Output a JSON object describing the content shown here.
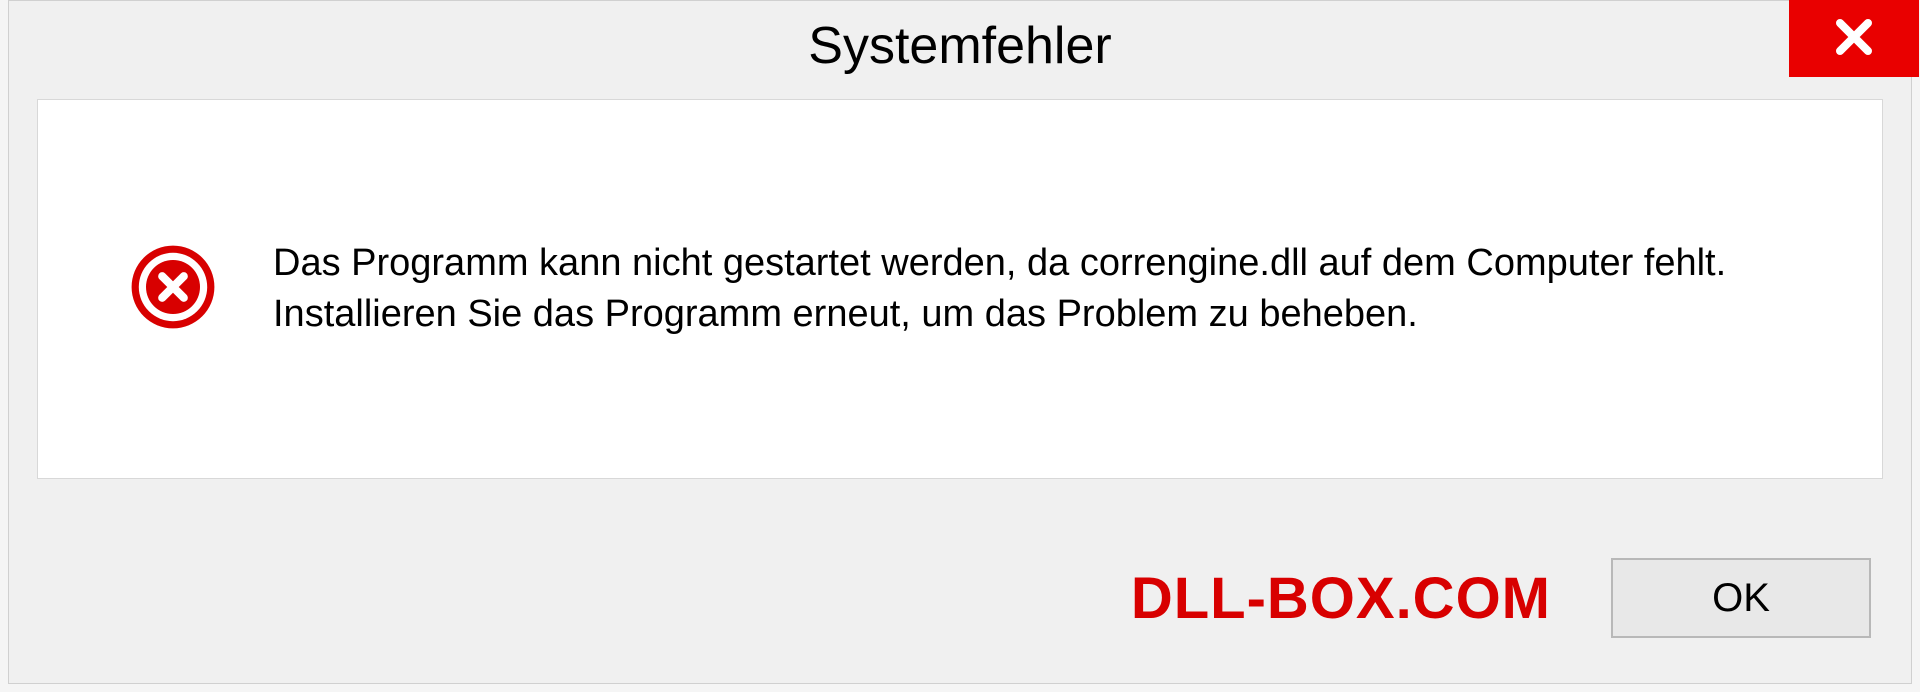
{
  "dialog": {
    "title": "Systemfehler",
    "message": "Das Programm kann nicht gestartet werden, da correngine.dll auf dem Computer fehlt. Installieren Sie das Programm erneut, um das Problem zu beheben.",
    "ok_label": "OK"
  },
  "watermark": "DLL-BOX.COM"
}
